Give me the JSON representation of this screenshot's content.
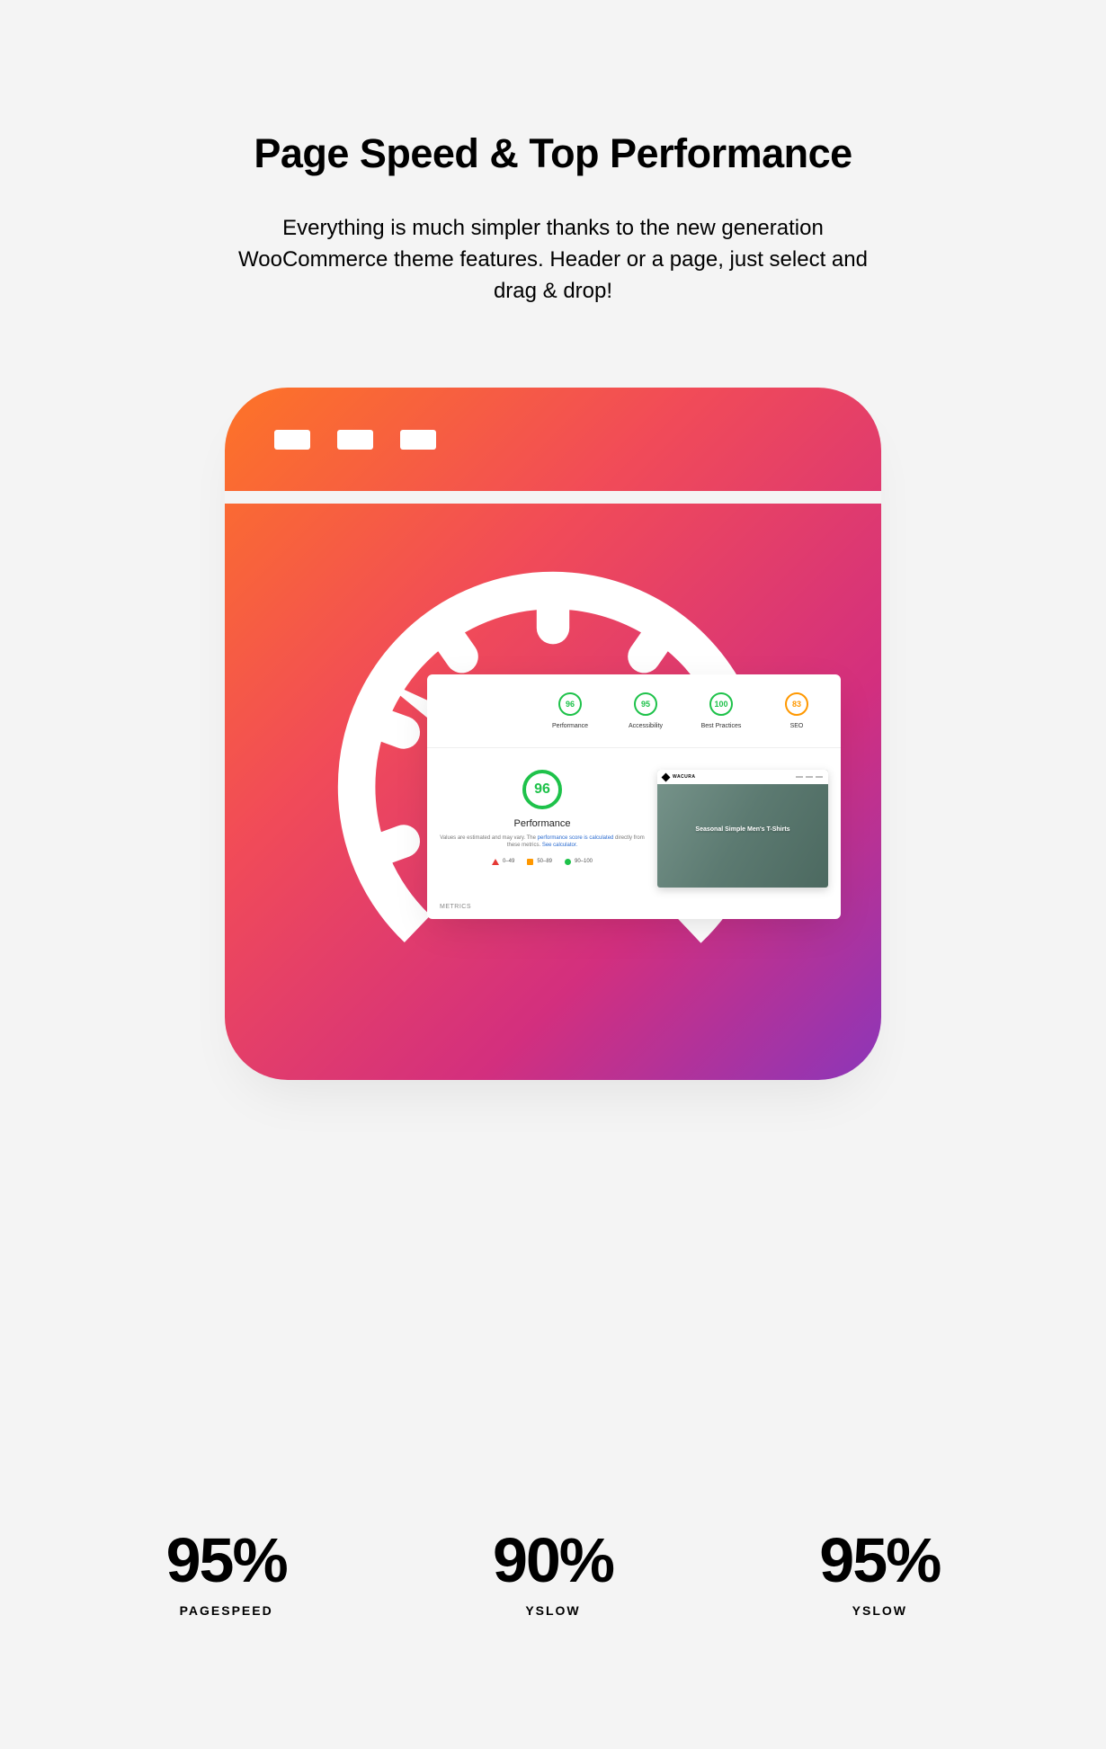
{
  "heading": "Page Speed & Top Performance",
  "subheading": "Everything is much simpler thanks to the new generation WooCommerce theme features. Header or a page, just select and drag & drop!",
  "panel": {
    "scores": [
      {
        "value": "96",
        "label": "Performance",
        "color": "green"
      },
      {
        "value": "95",
        "label": "Accessibility",
        "color": "green"
      },
      {
        "value": "100",
        "label": "Best Practices",
        "color": "green"
      },
      {
        "value": "83",
        "label": "SEO",
        "color": "orange"
      }
    ],
    "big_score": "96",
    "perf_title": "Performance",
    "desc_prefix": "Values are estimated and may vary. The ",
    "desc_link1": "performance score is calculated",
    "desc_mid": " directly from these metrics. ",
    "desc_link2": "See calculator.",
    "legend": {
      "a": "0–49",
      "b": "50–89",
      "c": "90–100"
    },
    "thumb_caption": "Seasonal Simple Men's T-Shirts",
    "thumb_brand": "WACURA",
    "metrics": "METRICS"
  },
  "stats": [
    {
      "value": "95%",
      "label": "PAGESPEED"
    },
    {
      "value": "90%",
      "label": "YSLOW"
    },
    {
      "value": "95%",
      "label": "YSLOW"
    }
  ]
}
